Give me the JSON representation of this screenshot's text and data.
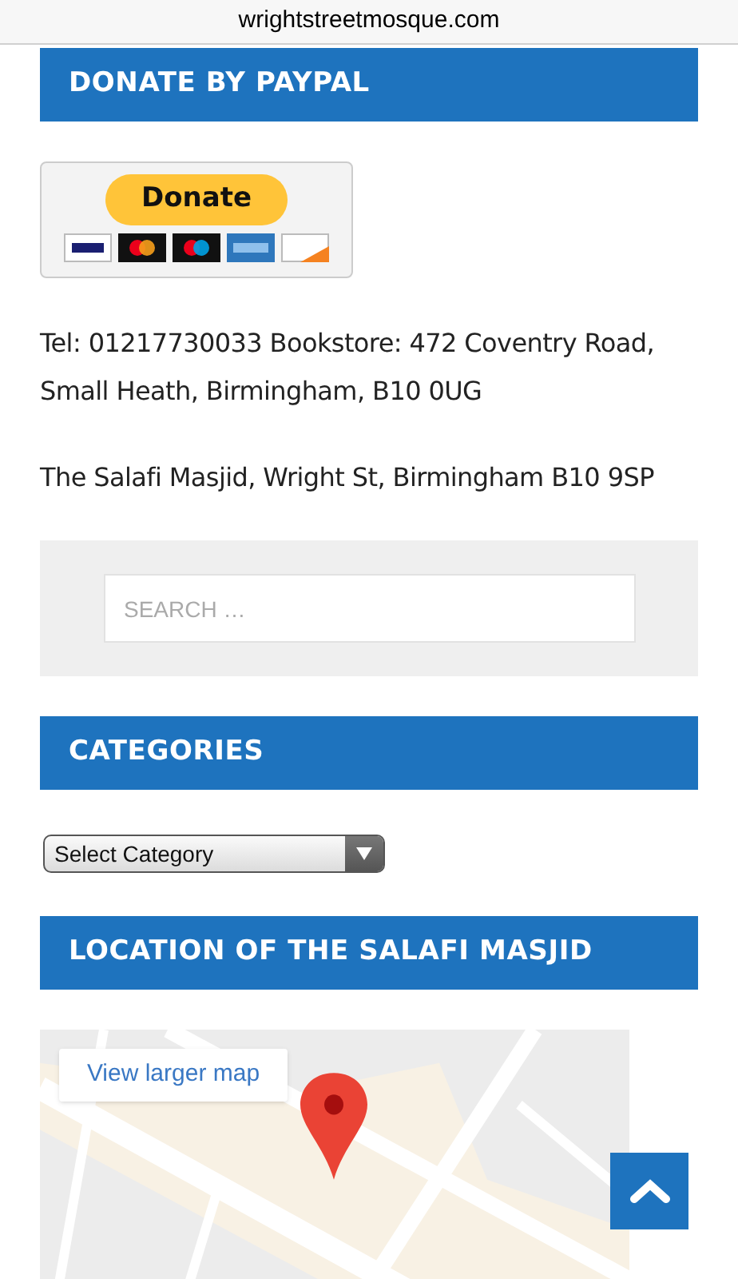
{
  "address_bar": {
    "url": "wrightstreetmosque.com"
  },
  "donate_section": {
    "heading": "DONATE BY PAYPAL",
    "button": {
      "label": "Donate"
    }
  },
  "contact": [
    "Tel: 01217730033 Bookstore: 472 Coventry Road, Small Heath, Birmingham, B10 0UG",
    "The Salafi Masjid, Wright St, Birmingham B10 9SP"
  ],
  "search": {
    "placeholder": "SEARCH …"
  },
  "categories": {
    "heading": "CATEGORIES",
    "select": {
      "value": "Select Category"
    }
  },
  "location": {
    "heading": "LOCATION OF THE SALAFI MASJID",
    "map": {
      "kind": "picture",
      "link": "View larger map"
    }
  }
}
